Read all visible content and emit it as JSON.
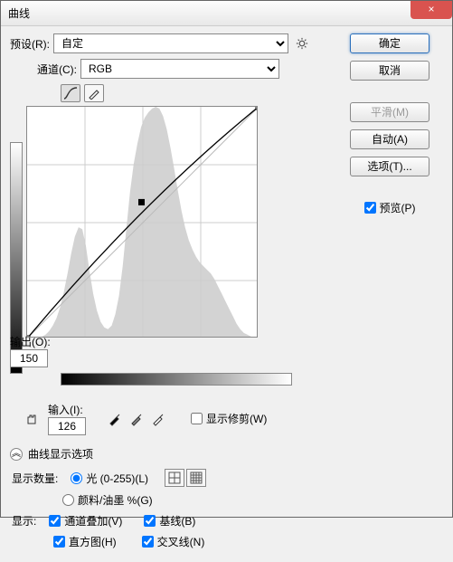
{
  "window": {
    "title": "曲线",
    "close": "×"
  },
  "preset": {
    "label": "预设(R):",
    "value": "自定"
  },
  "channel": {
    "label": "通道(C):",
    "value": "RGB"
  },
  "output": {
    "label": "输出(O):",
    "value": "150"
  },
  "input": {
    "label": "输入(I):",
    "value": "126"
  },
  "show_clip": "显示修剪(W)",
  "curve_options_title": "曲线显示选项",
  "show_amount": {
    "label": "显示数量:",
    "light": "光 (0-255)(L)",
    "pigment": "颜料/油墨 %(G)"
  },
  "display": {
    "label": "显示:",
    "overlay": "通道叠加(V)",
    "baseline": "基线(B)",
    "histogram": "直方图(H)",
    "intersection": "交叉线(N)"
  },
  "buttons": {
    "ok": "确定",
    "cancel": "取消",
    "smooth": "平滑(M)",
    "auto": "自动(A)",
    "options": "选项(T)..."
  },
  "preview": "预览(P)",
  "chart_data": {
    "type": "line",
    "title": "曲线",
    "xlabel": "输入",
    "ylabel": "输出",
    "xlim": [
      0,
      255
    ],
    "ylim": [
      0,
      255
    ],
    "points": [
      {
        "x": 0,
        "y": 0
      },
      {
        "x": 126,
        "y": 150
      },
      {
        "x": 255,
        "y": 255
      }
    ],
    "histogram": [
      0,
      0,
      0,
      0,
      2,
      4,
      8,
      14,
      22,
      34,
      50,
      70,
      92,
      110,
      120,
      118,
      100,
      72,
      48,
      30,
      18,
      12,
      10,
      14,
      26,
      46,
      78,
      118,
      158,
      188,
      210,
      228,
      238,
      244,
      248,
      250,
      248,
      240,
      226,
      206,
      184,
      160,
      138,
      120,
      106,
      96,
      88,
      82,
      78,
      74,
      70,
      64,
      56,
      48,
      40,
      32,
      24,
      16,
      10,
      6,
      4,
      2,
      0,
      0
    ]
  }
}
